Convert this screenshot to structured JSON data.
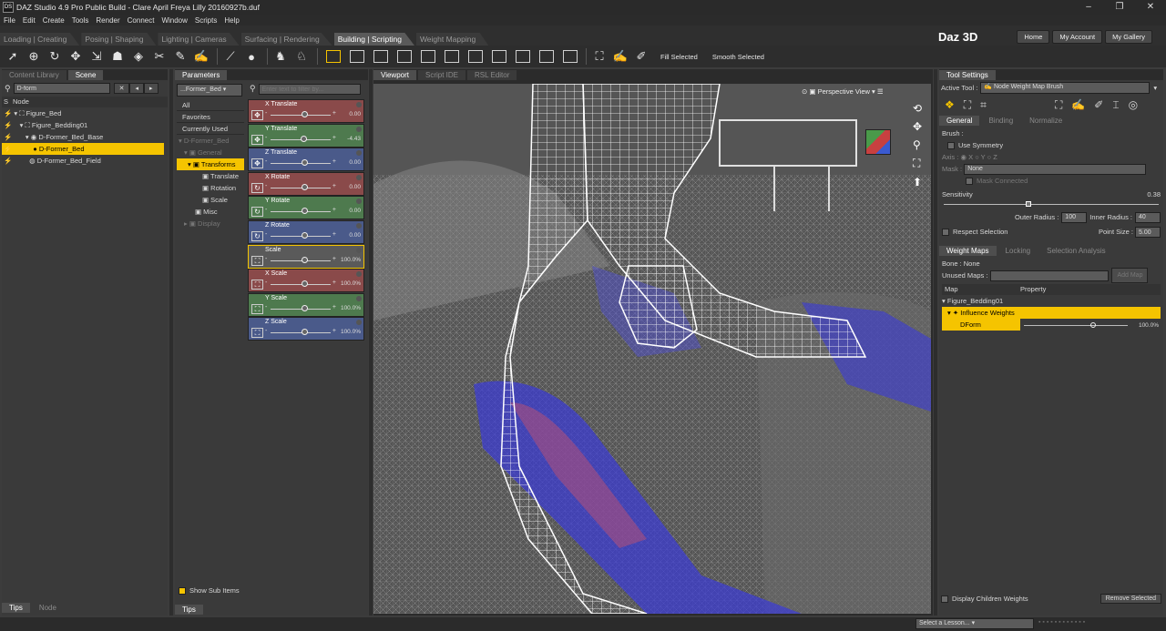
{
  "window": {
    "title": "DAZ Studio 4.9 Pro Public Build - Clare April Freya Lilly 20160927b.duf",
    "app_icon": "DS"
  },
  "menu": [
    "File",
    "Edit",
    "Create",
    "Tools",
    "Render",
    "Connect",
    "Window",
    "Scripts",
    "Help"
  ],
  "layout_tabs": [
    {
      "label": "Loading | Creating"
    },
    {
      "label": "Posing | Shaping"
    },
    {
      "label": "Lighting | Cameras"
    },
    {
      "label": "Surfacing | Rendering"
    },
    {
      "label": "Building | Scripting",
      "active": true
    },
    {
      "label": "Weight Mapping"
    }
  ],
  "brand": {
    "logo": "Daz 3D",
    "home": "Home",
    "account": "My Account",
    "gallery": "My Gallery"
  },
  "toolbar": {
    "fill_selected": "Fill Selected",
    "smooth_selected": "Smooth Selected"
  },
  "scene": {
    "tabs": [
      "Content Library",
      "Scene"
    ],
    "search_value": "D-form",
    "col_s": "S",
    "col_node": "Node",
    "nodes": [
      {
        "label": "Figure_Bed"
      },
      {
        "label": "Figure_Bedding01"
      },
      {
        "label": "D-Former_Bed_Base"
      },
      {
        "label": "D-Former_Bed",
        "selected": true
      },
      {
        "label": "D-Former_Bed_Field"
      }
    ],
    "bottom_tabs": [
      "Tips",
      "Node"
    ]
  },
  "parameters": {
    "tab": "Parameters",
    "node_select": "...Former_Bed",
    "filter_placeholder": "Enter text to filter by...",
    "categories": [
      {
        "label": "All"
      },
      {
        "label": "Favorites"
      },
      {
        "label": "Currently Used"
      },
      {
        "label": "D-Former_Bed"
      },
      {
        "label": "General"
      },
      {
        "label": "Transforms",
        "selected": true
      },
      {
        "label": "Translate"
      },
      {
        "label": "Rotation"
      },
      {
        "label": "Scale"
      },
      {
        "label": "Misc"
      },
      {
        "label": "Display"
      }
    ],
    "show_sub_items": "Show Sub Items",
    "bottom_tab": "Tips",
    "sliders": [
      {
        "label": "X Translate",
        "value": "0.00",
        "color": "#8a4a4a",
        "level": 0.5
      },
      {
        "label": "Y Translate",
        "value": "-4.43",
        "color": "#4e7a4e",
        "level": 0.48
      },
      {
        "label": "Z Translate",
        "value": "0.00",
        "color": "#4a5a8a",
        "level": 0.5
      },
      {
        "label": "X Rotate",
        "value": "0.00",
        "color": "#8a4a4a",
        "level": 0.5
      },
      {
        "label": "Y Rotate",
        "value": "0.00",
        "color": "#4e7a4e",
        "level": 0.5
      },
      {
        "label": "Z Rotate",
        "value": "0.00",
        "color": "#4a5a8a",
        "level": 0.5
      },
      {
        "label": "Scale",
        "value": "100.0%",
        "color": "#5a5a5a",
        "level": 0.5
      },
      {
        "label": "X Scale",
        "value": "100.0%",
        "color": "#8a4a4a",
        "level": 0.5
      },
      {
        "label": "Y Scale",
        "value": "100.0%",
        "color": "#4e7a4e",
        "level": 0.5
      },
      {
        "label": "Z Scale",
        "value": "100.0%",
        "color": "#4a5a8a",
        "level": 0.5
      }
    ]
  },
  "viewport": {
    "tabs": [
      "Viewport",
      "Script IDE",
      "RSL Editor"
    ],
    "view": "Perspective View"
  },
  "tool_settings": {
    "title": "Tool Settings",
    "active_tool_label": "Active Tool :",
    "active_tool": "Node Weight Map Brush",
    "tabs": [
      "General",
      "Binding",
      "Normalize"
    ],
    "brush_label": "Brush :",
    "use_symmetry": "Use Symmetry",
    "axis_label": "Axis :",
    "axes": [
      "X",
      "Y",
      "Z"
    ],
    "mask_label": "Mask :",
    "mask_value": "None",
    "mask_connected": "Mask Connected",
    "sensitivity_label": "Sensitivity",
    "sensitivity_value": "0.38",
    "sensitivity_level": 0.38,
    "outer_radius_label": "Outer Radius :",
    "outer_radius": "100",
    "inner_radius_label": "Inner Radius :",
    "inner_radius": "40",
    "respect_selection": "Respect Selection",
    "point_size_label": "Point Size :",
    "point_size": "5.00",
    "lower_tabs": [
      "Weight Maps",
      "Locking",
      "Selection Analysis"
    ],
    "bone_label": "Bone : None",
    "unused_maps_label": "Unused Maps :",
    "add_map": "Add Map",
    "col_map": "Map",
    "col_property": "Property",
    "tree": [
      {
        "label": "Figure_Bedding01"
      },
      {
        "label": "Influence Weights"
      },
      {
        "label": "DForm",
        "value": "100.0%"
      }
    ],
    "display_children": "Display Children Weights",
    "remove_selected": "Remove Selected"
  },
  "status": {
    "lesson": "Select a Lesson..."
  },
  "colors": {
    "accent": "#f5c400",
    "bg": "#3a3a3a"
  }
}
